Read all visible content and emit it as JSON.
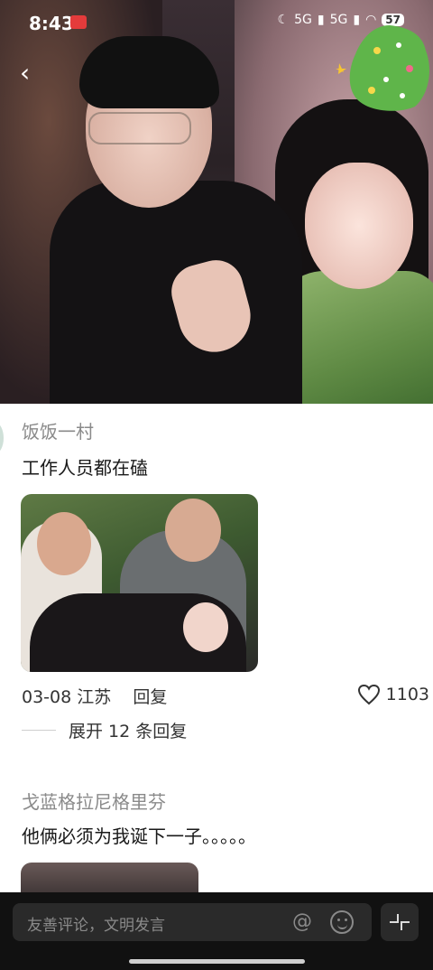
{
  "status": {
    "time": "8:43",
    "signal1": "5G",
    "signal2": "5G",
    "battery": "57"
  },
  "comments": [
    {
      "username": "饭饭一村",
      "text": "工作人员都在磕",
      "date": "03-08",
      "location": "江苏",
      "reply_label": "回复",
      "likes": "1103",
      "expand_label": "展开 12 条回复"
    },
    {
      "username": "戈蓝格拉尼格里芬",
      "text": "他俩必须为我诞下一子。。。。。"
    }
  ],
  "input": {
    "placeholder": "友善评论，文明发言"
  },
  "icons": {
    "back": "back-arrow-icon",
    "like": "heart-icon",
    "at": "at-mention-icon",
    "emoji": "emoji-icon",
    "collapse": "collapse-icon"
  },
  "colors": {
    "bottom_bar": "#111111",
    "username": "#8a8a8a",
    "text": "#1a1a1a"
  }
}
